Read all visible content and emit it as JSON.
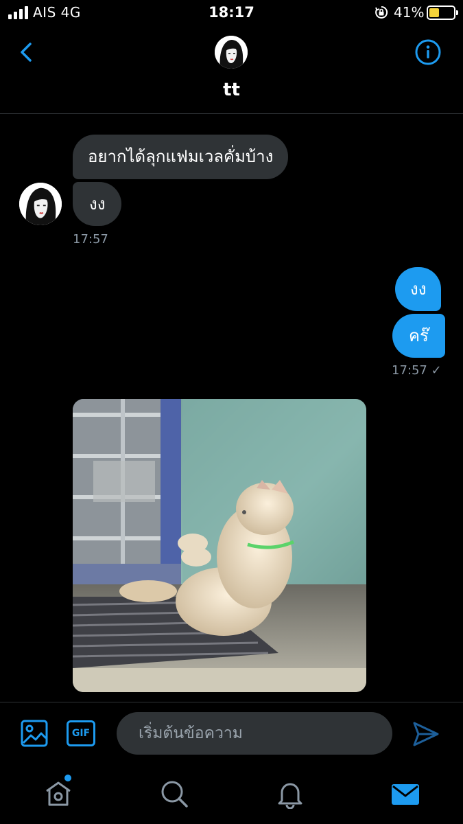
{
  "status_bar": {
    "carrier": "AIS  4G",
    "time": "18:17",
    "battery_percent": "41%",
    "battery_level": 0.41,
    "lock_icon": "orientation-lock-icon"
  },
  "header": {
    "back_icon": "chevron-left-icon",
    "contact_name": "tt",
    "info_icon": "info-icon"
  },
  "messages": [
    {
      "direction": "incoming",
      "text": "อยากได้ลุกแฟมเวลคั่มบ้าง"
    },
    {
      "direction": "incoming",
      "text": "งง"
    },
    {
      "direction": "incoming",
      "time": "17:57"
    },
    {
      "direction": "outgoing",
      "text": "งง"
    },
    {
      "direction": "outgoing",
      "text": "คร๊"
    },
    {
      "direction": "outgoing",
      "time": "17:57 ✓"
    },
    {
      "direction": "incoming",
      "media": "photo"
    }
  ],
  "composer": {
    "media_icon": "image-icon",
    "gif_label": "GIF",
    "placeholder": "เริ่มต้นข้อความ",
    "send_icon": "send-icon"
  },
  "tab_bar": {
    "items": [
      "home-icon",
      "search-icon",
      "notifications-icon",
      "messages-icon"
    ],
    "active": "messages-icon"
  },
  "colors": {
    "accent": "#1d9bf0",
    "incoming_bubble": "#2f3336",
    "background": "#000000"
  }
}
